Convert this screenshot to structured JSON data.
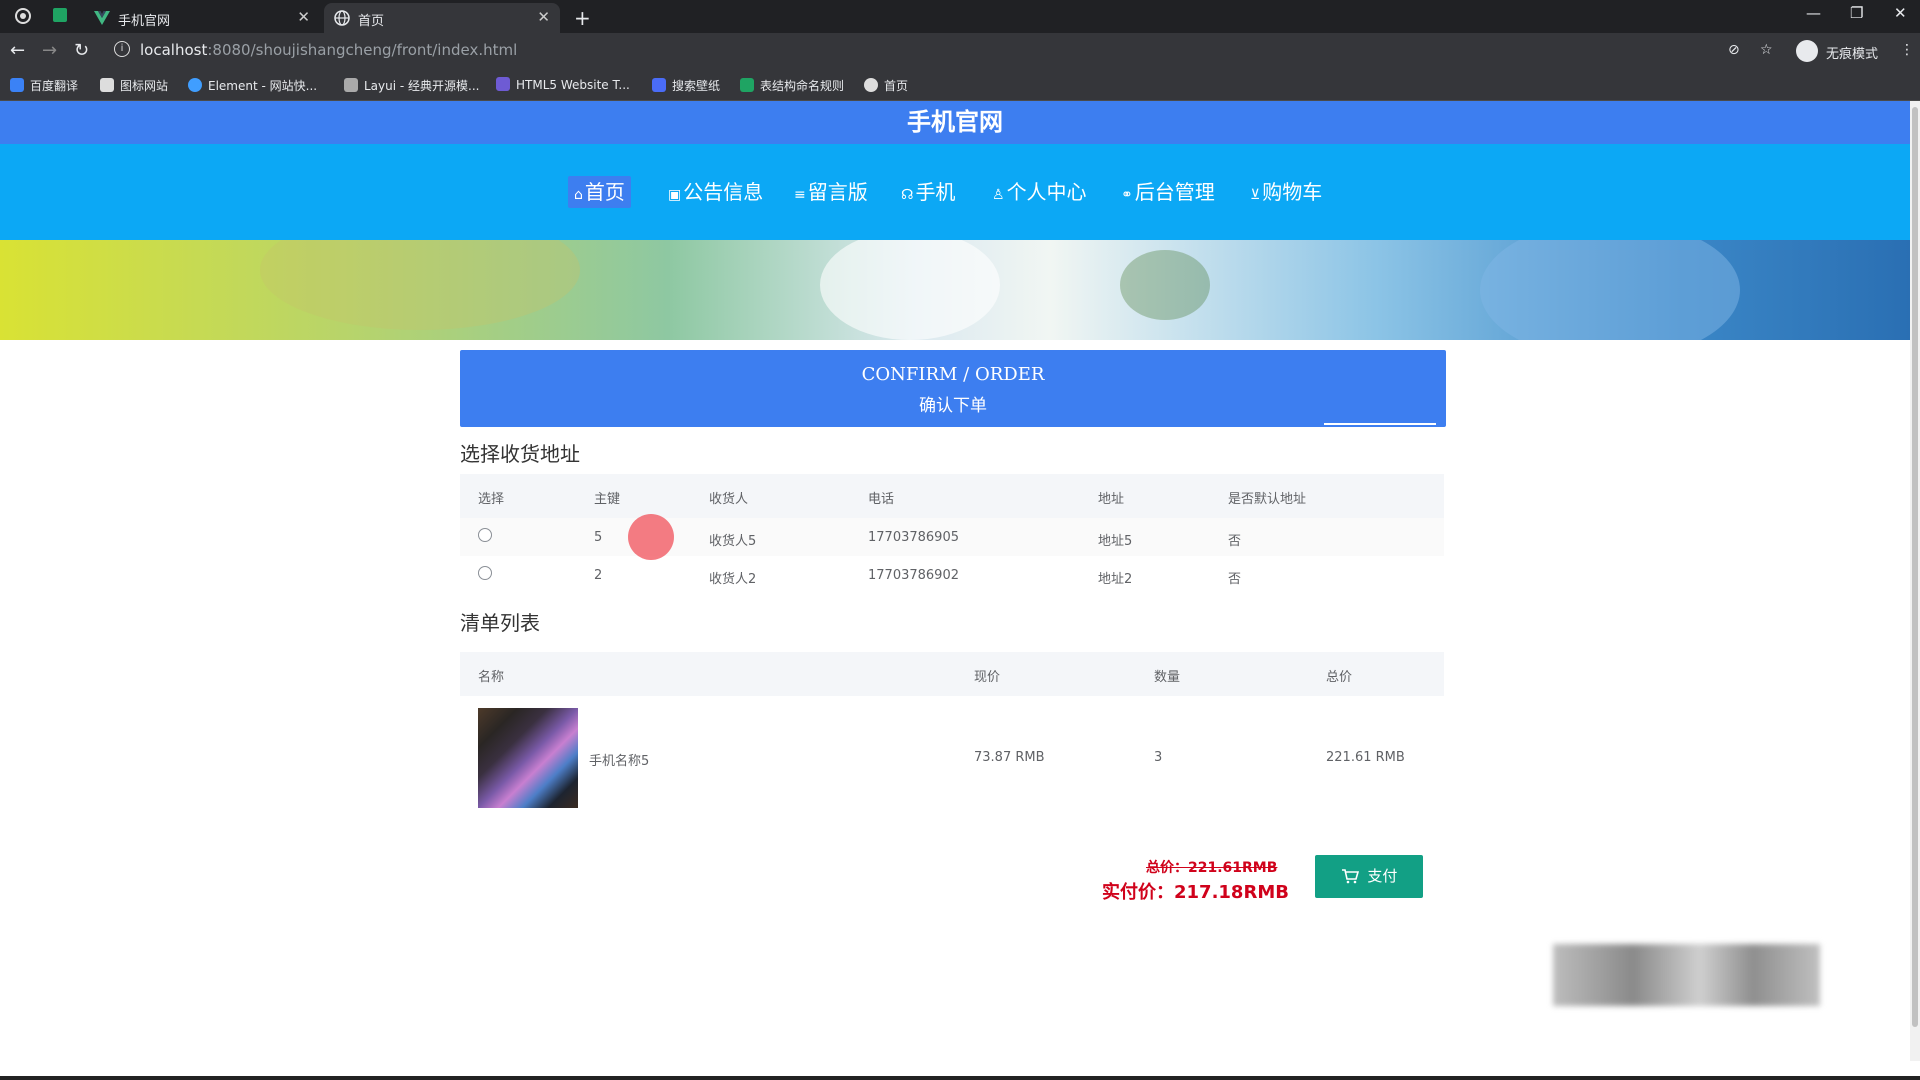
{
  "browser": {
    "tabs": [
      {
        "title": "手机官网",
        "active": false
      },
      {
        "title": "首页",
        "active": true
      }
    ],
    "url_host": "localhost",
    "url_path": ":8080/shoujishangcheng/front/index.html",
    "incognito_label": "无痕模式",
    "bookmarks": [
      "百度翻译",
      "图标网站",
      "Element - 网站快...",
      "Layui - 经典开源模...",
      "HTML5 Website T...",
      "搜索壁纸",
      "表结构命名规则",
      "首页"
    ]
  },
  "site": {
    "title": "手机官网",
    "nav": [
      {
        "label": "首页",
        "icon": "home-icon",
        "active": true
      },
      {
        "label": "公告信息",
        "icon": "notice-icon",
        "active": false
      },
      {
        "label": "留言版",
        "icon": "message-icon",
        "active": false
      },
      {
        "label": "手机",
        "icon": "phone-icon",
        "active": false
      },
      {
        "label": "个人中心",
        "icon": "user-icon",
        "active": false
      },
      {
        "label": "后台管理",
        "icon": "link-icon",
        "active": false
      },
      {
        "label": "购物车",
        "icon": "cart-icon",
        "active": false
      }
    ]
  },
  "confirm": {
    "en": "CONFIRM / ORDER",
    "zh": "确认下单"
  },
  "address": {
    "section_title": "选择收货地址",
    "columns": [
      "选择",
      "主键",
      "收货人",
      "电话",
      "地址",
      "是否默认地址"
    ],
    "rows": [
      {
        "id": "5",
        "receiver": "收货人5",
        "phone": "17703786905",
        "address": "地址5",
        "default": "否"
      },
      {
        "id": "2",
        "receiver": "收货人2",
        "phone": "17703786902",
        "address": "地址2",
        "default": "否"
      }
    ]
  },
  "cart": {
    "section_title": "清单列表",
    "columns": [
      "名称",
      "现价",
      "数量",
      "总价"
    ],
    "items": [
      {
        "name": "手机名称5",
        "price": "73.87 RMB",
        "qty": "3",
        "total": "221.61 RMB"
      }
    ]
  },
  "summary": {
    "original_total": "总价：221.61RMB",
    "paid_total": "实付价：217.18RMB",
    "pay_label": "支付"
  },
  "colors": {
    "primary": "#3d7ef0",
    "nav": "#0ca8f5",
    "pay": "#12a085",
    "price": "#d0021b"
  }
}
